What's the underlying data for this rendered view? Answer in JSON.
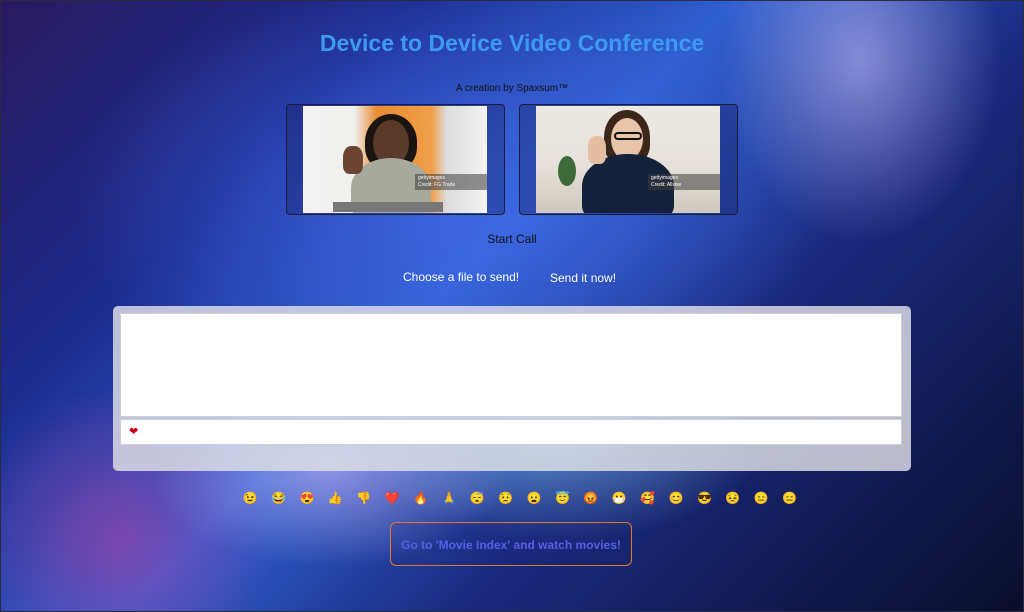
{
  "header": {
    "title": "Device to Device Video Conference",
    "subtitle": "A creation by Spaxsum™"
  },
  "videos": [
    {
      "watermark_brand": "gettyimages",
      "watermark_credit": "Credit: FG Trade"
    },
    {
      "watermark_brand": "gettyimages",
      "watermark_credit": "Credit: Allxise"
    }
  ],
  "controls": {
    "start_call": "Start Call",
    "choose_file": "Choose a file to send!",
    "send_file": "Send it now!"
  },
  "chat": {
    "input_value": "❤"
  },
  "emojis": [
    "😉",
    "😂",
    "😍",
    "👍",
    "👎",
    "❤️",
    "🔥",
    "🙏",
    "😴",
    "😟",
    "😦",
    "😇",
    "😡",
    "😷",
    "🥰",
    "😊",
    "😎",
    "😣",
    "😑",
    "😑"
  ],
  "footer": {
    "movie_button": "Go to 'Movie Index' and watch movies!"
  },
  "colors": {
    "title": "#3e9af0",
    "movie_button_border": "#e07a2a",
    "movie_button_text": "#5560e8"
  }
}
